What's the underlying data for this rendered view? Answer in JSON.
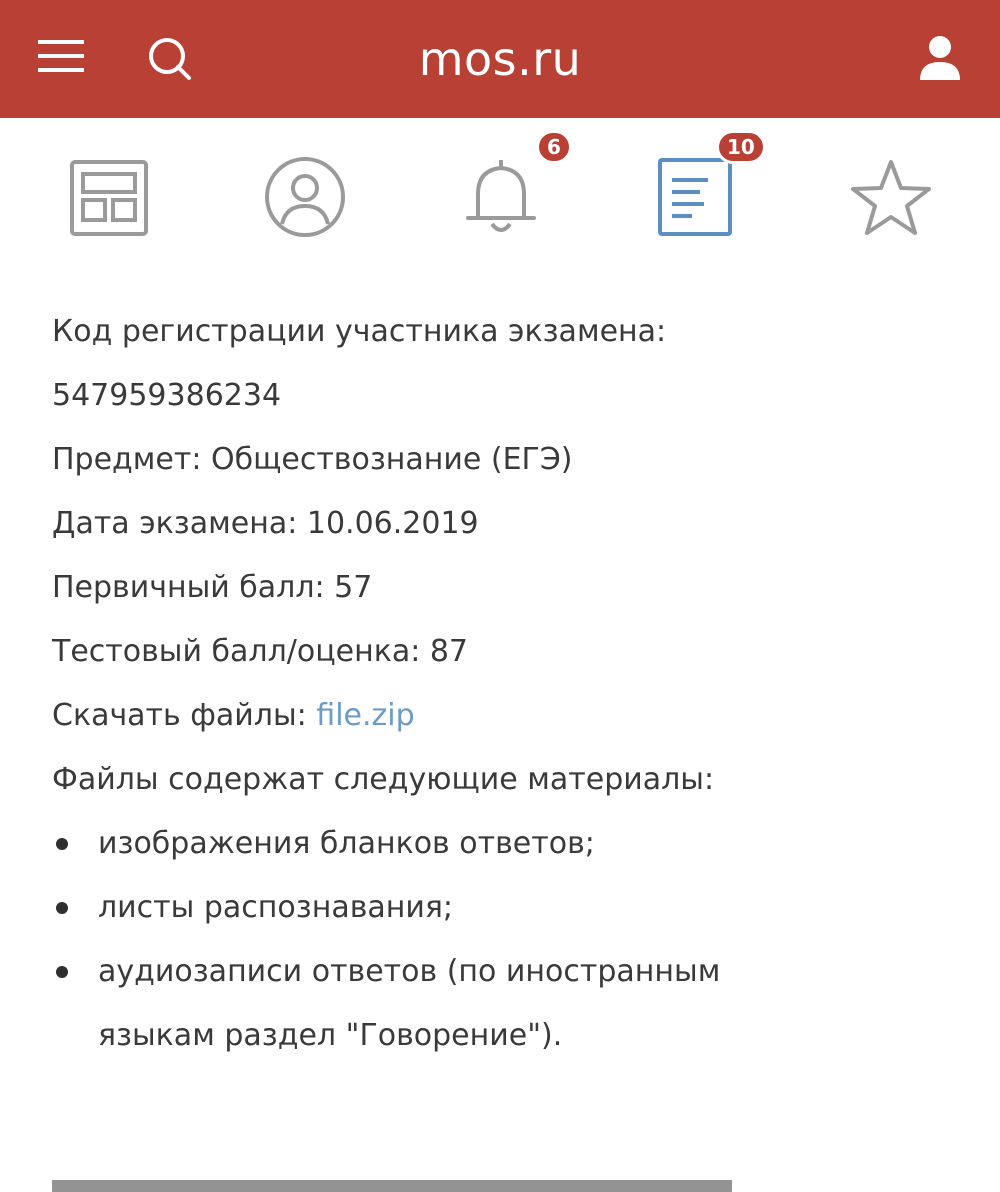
{
  "header": {
    "brand": "mos.ru",
    "menu_icon": "hamburger-menu-icon",
    "search_icon": "search-icon",
    "user_icon": "user-icon"
  },
  "iconbar": {
    "items": [
      {
        "name": "dashboard",
        "icon": "dashboard-grid-icon"
      },
      {
        "name": "profile",
        "icon": "profile-circle-icon"
      },
      {
        "name": "notifications",
        "icon": "bell-icon",
        "badge": "6"
      },
      {
        "name": "documents",
        "icon": "document-list-icon",
        "badge": "10",
        "active": true
      },
      {
        "name": "favorites",
        "icon": "star-icon"
      }
    ]
  },
  "content": {
    "reg_code_label": "Код регистрации участника экзамена:",
    "reg_code_value": "547959386234",
    "subject": "Предмет: Обществознание (ЕГЭ)",
    "exam_date": "Дата экзамена: 10.06.2019",
    "primary_score": "Первичный балл: 57",
    "test_score": "Тестовый балл/оценка: 87",
    "download_label": "Скачать файлы: ",
    "download_link": "file.zip",
    "files_intro": "Файлы содержат следующие материалы:",
    "materials": [
      "изображения бланков ответов;",
      "листы распознавания;",
      "аудиозаписи ответов (по иностранным",
      "языкам раздел \"Говорение\")."
    ]
  },
  "colors": {
    "header_bg": "#b94035",
    "active_icon": "#5b8fc4",
    "inactive_icon": "#9a9a9a",
    "link": "#6a9cc7"
  }
}
